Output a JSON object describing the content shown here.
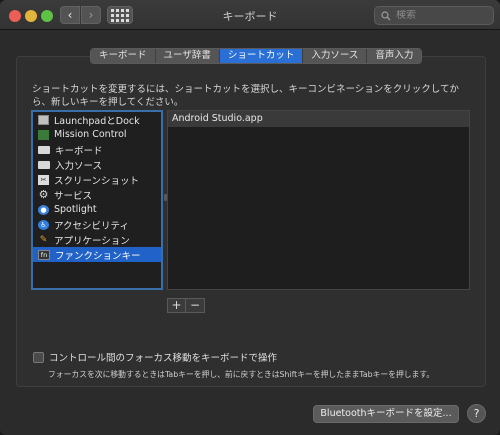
{
  "window": {
    "title": "キーボード"
  },
  "search": {
    "placeholder": "検索"
  },
  "tabs": [
    {
      "label": "キーボード",
      "active": false
    },
    {
      "label": "ユーザ辞書",
      "active": false
    },
    {
      "label": "ショートカット",
      "active": true
    },
    {
      "label": "入力ソース",
      "active": false
    },
    {
      "label": "音声入力",
      "active": false
    }
  ],
  "description": "ショートカットを変更するには、ショートカットを選択し、キーコンビネーションをクリックしてから、新しいキーを押してください。",
  "categories": [
    {
      "label": "LaunchpadとDock",
      "icon": "launchpad-dock-icon"
    },
    {
      "label": "Mission Control",
      "icon": "mission-control-icon"
    },
    {
      "label": "キーボード",
      "icon": "keyboard-icon"
    },
    {
      "label": "入力ソース",
      "icon": "input-source-icon"
    },
    {
      "label": "スクリーンショット",
      "icon": "screenshot-icon"
    },
    {
      "label": "サービス",
      "icon": "gear-icon"
    },
    {
      "label": "Spotlight",
      "icon": "spotlight-icon"
    },
    {
      "label": "アクセシビリティ",
      "icon": "accessibility-icon"
    },
    {
      "label": "アプリケーション",
      "icon": "applications-icon"
    },
    {
      "label": "ファンクションキー",
      "icon": "fn-key-icon",
      "selected": true
    }
  ],
  "shortcuts": [
    {
      "label": "Android Studio.app"
    }
  ],
  "buttons": {
    "add": "+",
    "remove": "−",
    "bluetooth": "Bluetoothキーボードを設定...",
    "help": "?"
  },
  "focus_checkbox": {
    "label": "コントロール間のフォーカス移動をキーボードで操作",
    "checked": false,
    "hint": "フォーカスを次に移動するときはTabキーを押し、前に戻すときはShiftキーを押したままTabキーを押します。"
  },
  "colors": {
    "accent": "#2162c9",
    "close": "#ec5f57",
    "minimize": "#e1b43b",
    "maximize": "#5fc245"
  }
}
